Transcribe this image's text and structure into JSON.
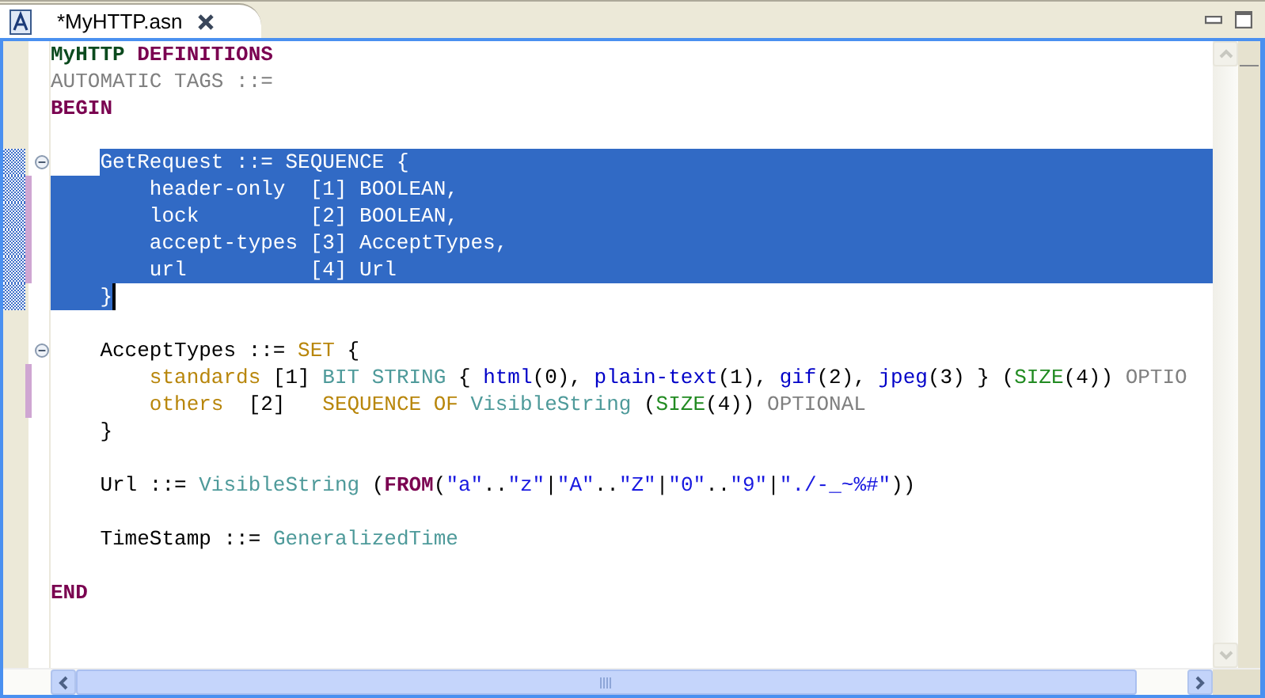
{
  "tab": {
    "title": "*MyHTTP.asn",
    "selected": true
  },
  "lines": [
    {
      "selected": false,
      "changed": false,
      "foldable": false,
      "tokens": [
        {
          "text": "MyHTTP ",
          "kind": "module"
        },
        {
          "text": "DEFINITIONS",
          "kind": "keyword"
        }
      ]
    },
    {
      "selected": false,
      "changed": false,
      "foldable": false,
      "tokens": [
        {
          "text": "AUTOMATIC TAGS ::=",
          "kind": "dim"
        }
      ]
    },
    {
      "selected": false,
      "changed": false,
      "foldable": false,
      "tokens": [
        {
          "text": "BEGIN",
          "kind": "keyword"
        }
      ]
    },
    {
      "selected": false,
      "changed": false,
      "foldable": false
    },
    {
      "selected": true,
      "changed": false,
      "foldable": true,
      "tokens": [
        {
          "text": "    GetRequest ::= SEQUENCE {",
          "kind": "plain"
        }
      ]
    },
    {
      "selected": true,
      "changed": true,
      "foldable": false,
      "tokens": [
        {
          "text": "        header-only  [1] BOOLEAN,",
          "kind": "plain"
        }
      ]
    },
    {
      "selected": true,
      "changed": true,
      "foldable": false,
      "tokens": [
        {
          "text": "        lock         [2] BOOLEAN,",
          "kind": "plain"
        }
      ]
    },
    {
      "selected": true,
      "changed": true,
      "foldable": false,
      "tokens": [
        {
          "text": "        accept-types [3] AcceptTypes,",
          "kind": "plain"
        }
      ]
    },
    {
      "selected": true,
      "changed": true,
      "foldable": false,
      "tokens": [
        {
          "text": "        url          [4] Url",
          "kind": "plain"
        }
      ]
    },
    {
      "selected": true,
      "changed": false,
      "foldable": false,
      "tokens": [
        {
          "text": "    }",
          "kind": "plain"
        }
      ]
    },
    {
      "selected": false,
      "changed": false,
      "foldable": false
    },
    {
      "selected": false,
      "changed": false,
      "foldable": true,
      "tokens": [
        {
          "text": "    AcceptTypes ::= ",
          "kind": "plain"
        },
        {
          "text": "SET",
          "kind": "builtin"
        },
        {
          "text": " {",
          "kind": "plain"
        }
      ]
    },
    {
      "selected": false,
      "changed": true,
      "foldable": false,
      "tokens": [
        {
          "text": "        standards",
          "kind": "builtin"
        },
        {
          "text": " [1] ",
          "kind": "plain"
        },
        {
          "text": "BIT STRING",
          "kind": "type"
        },
        {
          "text": " { ",
          "kind": "plain"
        },
        {
          "text": "html",
          "kind": "named"
        },
        {
          "text": "(0), ",
          "kind": "plain"
        },
        {
          "text": "plain-text",
          "kind": "named"
        },
        {
          "text": "(1), ",
          "kind": "plain"
        },
        {
          "text": "gif",
          "kind": "named"
        },
        {
          "text": "(2), ",
          "kind": "plain"
        },
        {
          "text": "jpeg",
          "kind": "named"
        },
        {
          "text": "(3) } (",
          "kind": "plain"
        },
        {
          "text": "SIZE",
          "kind": "constraint"
        },
        {
          "text": "(4)) ",
          "kind": "plain"
        },
        {
          "text": "OPTIO",
          "kind": "dim"
        }
      ]
    },
    {
      "selected": false,
      "changed": true,
      "foldable": false,
      "tokens": [
        {
          "text": "        others",
          "kind": "builtin"
        },
        {
          "text": "  [2]   ",
          "kind": "plain"
        },
        {
          "text": "SEQUENCE OF ",
          "kind": "builtin"
        },
        {
          "text": "VisibleString",
          "kind": "type"
        },
        {
          "text": " (",
          "kind": "plain"
        },
        {
          "text": "SIZE",
          "kind": "constraint"
        },
        {
          "text": "(4)) ",
          "kind": "plain"
        },
        {
          "text": "OPTIONAL",
          "kind": "dim"
        }
      ]
    },
    {
      "selected": false,
      "changed": false,
      "foldable": false,
      "tokens": [
        {
          "text": "    }",
          "kind": "plain"
        }
      ]
    },
    {
      "selected": false,
      "changed": false,
      "foldable": false
    },
    {
      "selected": false,
      "changed": false,
      "foldable": false,
      "tokens": [
        {
          "text": "    Url ::= ",
          "kind": "plain"
        },
        {
          "text": "VisibleString",
          "kind": "type"
        },
        {
          "text": " (",
          "kind": "plain"
        },
        {
          "text": "FROM",
          "kind": "keyword"
        },
        {
          "text": "(",
          "kind": "plain"
        },
        {
          "text": "\"a\"",
          "kind": "string"
        },
        {
          "text": "..",
          "kind": "plain"
        },
        {
          "text": "\"z\"",
          "kind": "string"
        },
        {
          "text": "|",
          "kind": "plain"
        },
        {
          "text": "\"A\"",
          "kind": "string"
        },
        {
          "text": "..",
          "kind": "plain"
        },
        {
          "text": "\"Z\"",
          "kind": "string"
        },
        {
          "text": "|",
          "kind": "plain"
        },
        {
          "text": "\"0\"",
          "kind": "string"
        },
        {
          "text": "..",
          "kind": "plain"
        },
        {
          "text": "\"9\"",
          "kind": "string"
        },
        {
          "text": "|",
          "kind": "plain"
        },
        {
          "text": "\"./-_~%#\"",
          "kind": "string"
        },
        {
          "text": "))",
          "kind": "plain"
        }
      ]
    },
    {
      "selected": false,
      "changed": false,
      "foldable": false
    },
    {
      "selected": false,
      "changed": false,
      "foldable": false,
      "tokens": [
        {
          "text": "    TimeStamp ::= ",
          "kind": "plain"
        },
        {
          "text": "GeneralizedTime",
          "kind": "type"
        }
      ]
    },
    {
      "selected": false,
      "changed": false,
      "foldable": false
    },
    {
      "selected": false,
      "changed": false,
      "foldable": false,
      "tokens": [
        {
          "text": "END",
          "kind": "keyword"
        }
      ]
    }
  ]
}
